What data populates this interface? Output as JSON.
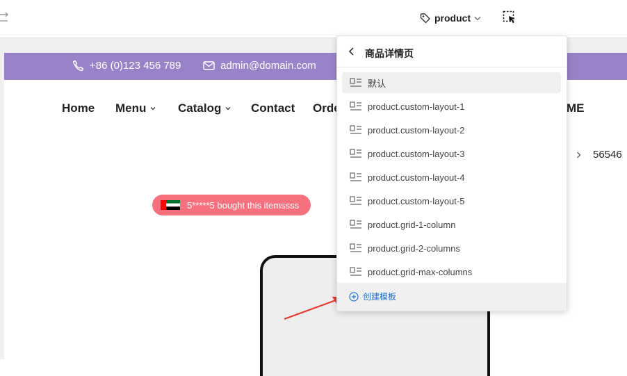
{
  "editor_bar": {
    "template_selector": {
      "label": "product"
    }
  },
  "site": {
    "topbar": {
      "phone": "+86 (0)123 456 789",
      "email": "admin@domain.com"
    },
    "nav": {
      "items": [
        {
          "label": "Home"
        },
        {
          "label": "Menu"
        },
        {
          "label": "Catalog"
        },
        {
          "label": "Contact"
        },
        {
          "label": "Orde"
        },
        {
          "label": "ME"
        }
      ]
    },
    "breadcrumb_last": "56546",
    "social_proof": "5*****5 bought this itemssss"
  },
  "dropdown": {
    "title": "商品详情页",
    "items": [
      {
        "label": "默认",
        "selected": true
      },
      {
        "label": "product.custom-layout-1"
      },
      {
        "label": "product.custom-layout-2"
      },
      {
        "label": "product.custom-layout-3"
      },
      {
        "label": "product.custom-layout-4"
      },
      {
        "label": "product.custom-layout-5"
      },
      {
        "label": "product.grid-1-column"
      },
      {
        "label": "product.grid-2-columns"
      },
      {
        "label": "product.grid-max-columns"
      }
    ],
    "create_label": "创建模板"
  },
  "colors": {
    "topbar": "#9a82c8",
    "badge": "#f7707d",
    "link": "#1d6fd8",
    "annotation_arrow": "#e8362a"
  }
}
